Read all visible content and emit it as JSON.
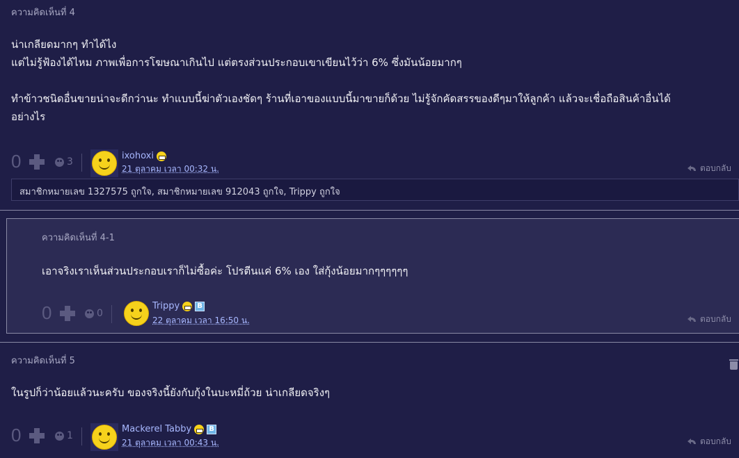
{
  "comments": [
    {
      "title": "ความคิดเห็นที่ 4",
      "lines": [
        "น่าเกลียดมากๆ ทำได้ไง",
        "แต่ไม่รู้ฟ้องได้ไหม ภาพเพื่อการโฆษณาเกินไป แต่ตรงส่วนประกอบเขาเขียนไว้ว่า 6% ซึ่งมันน้อยมากๆ",
        "ทำข้าวชนิดอื่นขายน่าจะดีกว่านะ ทำแบบนี้ฆ่าตัวเองชัดๆ ร้านที่เอาของแบบนี้มาขายก็ด้วย ไม่รู้จักคัดสรรของดีๆมาให้ลูกค้า แล้วจะเชื่อถือสินค้าอื่นได้",
        "อย่างไร"
      ],
      "votes": "0",
      "emotions": "3",
      "username": "ixohoxi",
      "date": "21 ตุลาคม เวลา 00:32 น.",
      "reply_label": "ตอบกลับ",
      "likes_text": "สมาชิกหมายเลข 1327575 ถูกใจ, สมาชิกหมายเลข 912043 ถูกใจ, Trippy ถูกใจ"
    },
    {
      "title": "ความคิดเห็นที่ 4-1",
      "lines": [
        "เอาจริงเราเห็นส่วนประกอบเราก็ไม่ซื้อค่ะ โปรตีนแค่ 6% เอง ใส่กุ้งน้อยมากๆๆๆๆๆๆ"
      ],
      "votes": "0",
      "emotions": "0",
      "username": "Trippy",
      "badge": "B",
      "date": "22 ตุลาคม เวลา 16:50 น.",
      "reply_label": "ตอบกลับ"
    },
    {
      "title": "ความคิดเห็นที่ 5",
      "lines": [
        "ในรูปก็ว่าน้อยแล้วนะครับ ของจริงนี้ยังกับกุ้งในบะหมี่ถ้วย น่าเกลียดจริงๆ"
      ],
      "votes": "0",
      "emotions": "1",
      "username": "Mackerel Tabby",
      "badge": "B",
      "date": "21 ตุลาคม เวลา 00:43 น.",
      "reply_label": "ตอบกลับ"
    }
  ],
  "icons": [
    "plus-icon",
    "emotion-icon",
    "avatar-icon",
    "grin-icon",
    "b-badge-icon",
    "reply-icon",
    "trash-icon"
  ]
}
